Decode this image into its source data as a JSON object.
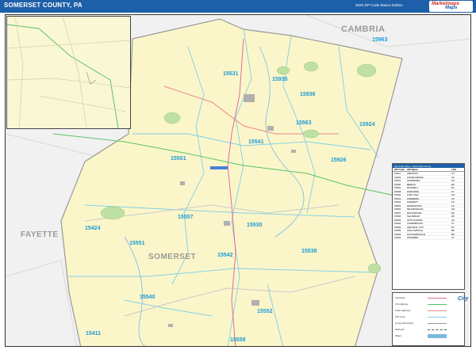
{
  "header": {
    "title": "SOMERSET COUNTY, PA",
    "edition": "2020 ZIP Code Basics Edition",
    "logo_line1": "Marketmaps",
    "logo_line2": "Maps"
  },
  "place_labels": {
    "cambria": "CAMBRIA",
    "fayette": "FAYETTE",
    "somerset": "SOMERSET"
  },
  "zip_labels": {
    "z15963": "15963",
    "z15531": "15531",
    "z15935": "15935",
    "z15936": "15936",
    "z15563": "15563",
    "z15924": "15924",
    "z15541": "15541",
    "z15501": "15501",
    "z15926": "15926",
    "z15557": "15557",
    "z15530": "15530",
    "z15424": "15424",
    "z15551": "15551",
    "z15542": "15542",
    "z15538": "15538",
    "z15540": "15540",
    "z15552": "15552",
    "z15411": "15411",
    "z15558": "15558"
  },
  "zip_table": {
    "title": "Zip Code Index - Somerset County",
    "headers": [
      "ZIP Code",
      "ZIP Name",
      "LOC"
    ],
    "rows": [
      [
        "15411",
        "ADDISON",
        "G7"
      ],
      [
        "15424",
        "CONFLUENCE",
        "F3"
      ],
      [
        "15501",
        "SOMERSET",
        "D4"
      ],
      [
        "15530",
        "BERLIN",
        "E6"
      ],
      [
        "15531",
        "BOSWELL",
        "B4"
      ],
      [
        "15538",
        "FAIRHOPE",
        "F7"
      ],
      [
        "15540",
        "FORT HILL",
        "G5"
      ],
      [
        "15541",
        "FRIEDENS",
        "C5"
      ],
      [
        "15542",
        "GARRETT",
        "F5"
      ],
      [
        "15551",
        "MARKLETON",
        "F4"
      ],
      [
        "15552",
        "MEYERSDALE",
        "G6"
      ],
      [
        "15557",
        "ROCKWOOD",
        "E4"
      ],
      [
        "15558",
        "SALISBURY",
        "H5"
      ],
      [
        "15563",
        "STOYSTOWN",
        "C6"
      ],
      [
        "15924",
        "CAIRNBROOK",
        "C7"
      ],
      [
        "15926",
        "CENTRAL CITY",
        "D7"
      ],
      [
        "15935",
        "HOLLSOPPLE",
        "B5"
      ],
      [
        "15936",
        "HOOVERSVILLE",
        "B6"
      ],
      [
        "15963",
        "WINDBER",
        "A7"
      ]
    ]
  },
  "legend": {
    "items": [
      "Interstate",
      "US Highway",
      "State Highway",
      "ZIP Code",
      "County Boundary",
      "Railroad",
      "Water"
    ],
    "city_logo": "City"
  }
}
